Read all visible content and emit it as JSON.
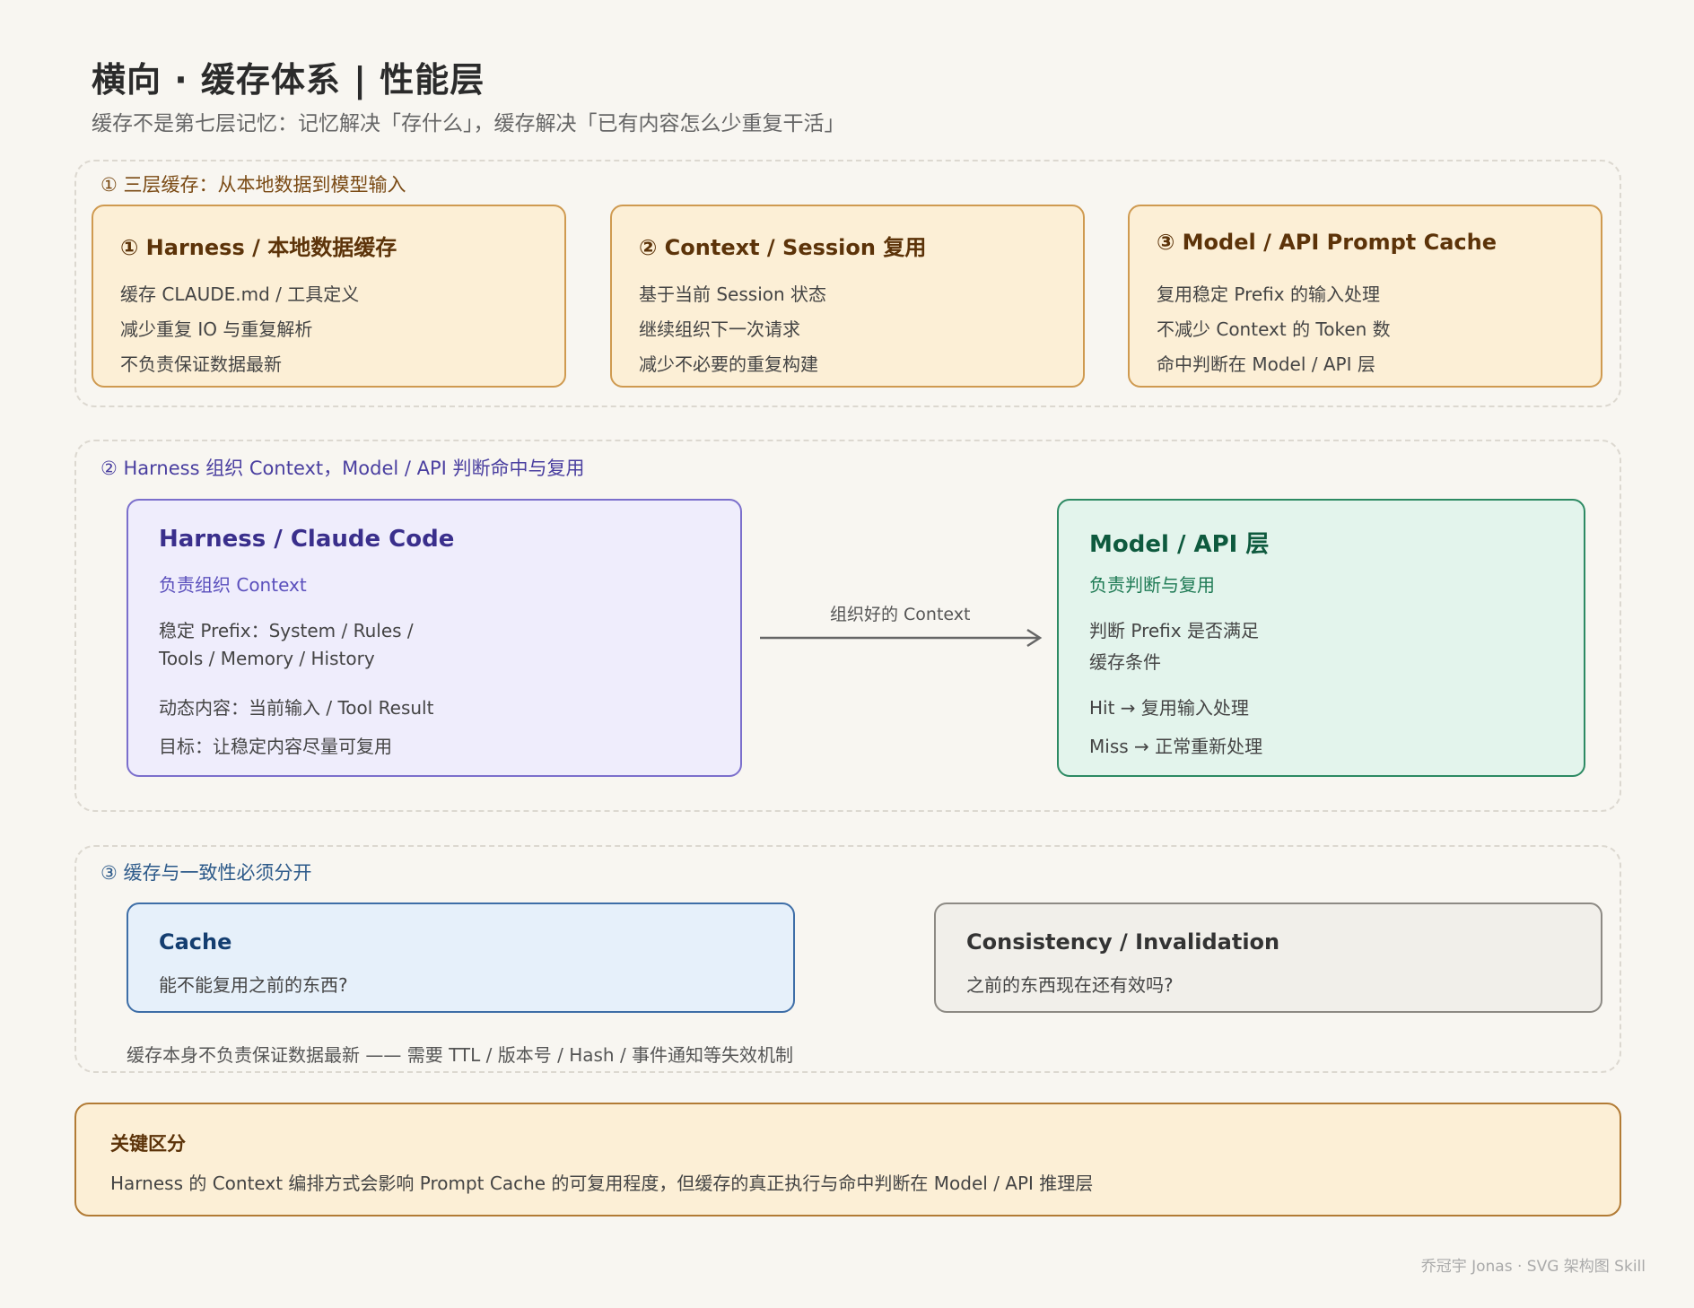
{
  "header": {
    "title": "横向 · 缓存体系 | 性能层",
    "subtitle": "缓存不是第七层记忆：记忆解决「存什么」，缓存解决「已有内容怎么少重复干活」"
  },
  "section1": {
    "label": "① 三层缓存：从本地数据到模型输入",
    "cards": [
      {
        "title": "① Harness / 本地数据缓存",
        "lines": [
          "缓存 CLAUDE.md / 工具定义",
          "减少重复 IO 与重复解析",
          "不负责保证数据最新"
        ]
      },
      {
        "title": "② Context / Session 复用",
        "lines": [
          "基于当前 Session 状态",
          "继续组织下一次请求",
          "减少不必要的重复构建"
        ]
      },
      {
        "title": "③ Model / API Prompt Cache",
        "lines": [
          "复用稳定 Prefix 的输入处理",
          "不减少 Context 的 Token 数",
          "命中判断在 Model / API 层"
        ]
      }
    ]
  },
  "section2": {
    "label": "② Harness 组织 Context，Model / API 判断命中与复用",
    "harness": {
      "title": "Harness / Claude Code",
      "subtitle": "负责组织 Context",
      "lines": [
        "稳定 Prefix：System / Rules /",
        "Tools / Memory / History",
        "动态内容：当前输入 / Tool Result",
        "目标：让稳定内容尽量可复用"
      ]
    },
    "arrow_label": "组织好的 Context",
    "model": {
      "title": "Model / API 层",
      "subtitle": "负责判断与复用",
      "lines": [
        "判断 Prefix 是否满足",
        "缓存条件",
        "Hit → 复用输入处理",
        "Miss → 正常重新处理"
      ]
    }
  },
  "section3": {
    "label": "③ 缓存与一致性必须分开",
    "cache": {
      "title": "Cache",
      "line": "能不能复用之前的东西?"
    },
    "consistency": {
      "title": "Consistency / Invalidation",
      "line": "之前的东西现在还有效吗?"
    },
    "note": "缓存本身不负责保证数据最新 —— 需要 TTL / 版本号 / Hash / 事件通知等失效机制"
  },
  "key": {
    "title": "关键区分",
    "text": "Harness 的 Context 编排方式会影响 Prompt Cache 的可复用程度，但缓存的真正执行与命中判断在 Model / API 推理层"
  },
  "footer": "乔冠宇 Jonas · SVG 架构图 Skill",
  "colors": {
    "amber": "#cf9a50",
    "purple": "#7b6fcc",
    "green": "#2d8a63",
    "blue": "#3e6ea7",
    "gray": "#8d8a84"
  }
}
